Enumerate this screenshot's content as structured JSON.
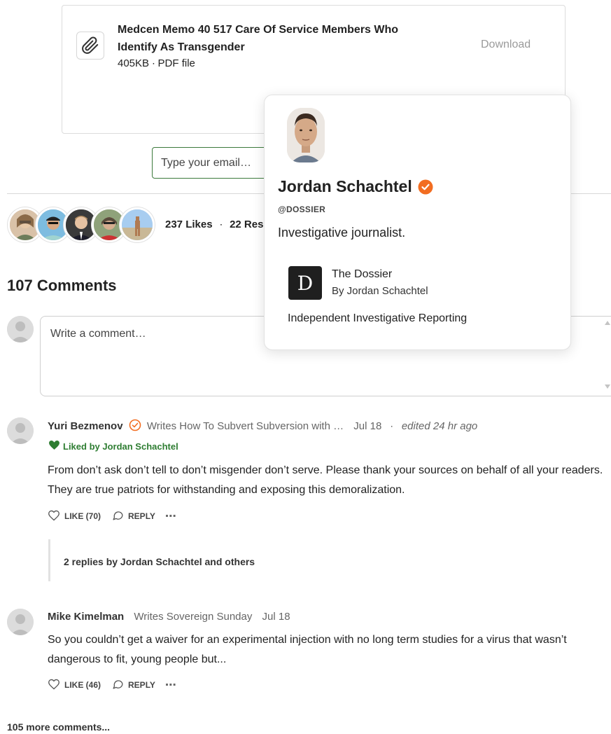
{
  "attachment": {
    "title": "Medcen Memo 40 517 Care Of Service Members Who Identify As Transgender",
    "meta": "405KB ∙ PDF file",
    "download_label": "Download"
  },
  "email": {
    "placeholder": "Type your email…"
  },
  "likes": {
    "likes_count": "237 Likes",
    "separator": "∙",
    "restacks": "22 Res"
  },
  "comments": {
    "heading": "107 Comments",
    "input_placeholder": "Write a comment…",
    "items": [
      {
        "author": "Yuri Bezmenov",
        "writes": "Writes How To Subvert Subversion with …",
        "date": "Jul 18",
        "separator": "∙",
        "edited": "edited 24 hr ago",
        "liked_by": "Liked by Jordan Schachtel",
        "body": "From don’t ask don’t tell to don’t misgender don’t serve. Please thank your sources on behalf of all your readers. They are true patriots for withstanding and exposing this demoralization.",
        "like_label": "LIKE (70)",
        "reply_label": "REPLY",
        "more": "⋯"
      },
      {
        "author": "Mike Kimelman",
        "writes": "Writes Sovereign Sunday",
        "date": "Jul 18",
        "body": "So you couldn’t get a waiver for an experimental injection with no long term studies for a virus that wasn’t dangerous to fit, young people but...",
        "like_label": "LIKE (46)",
        "reply_label": "REPLY",
        "more": "⋯"
      }
    ],
    "replies_link": "2 replies by Jordan Schachtel and others",
    "more_comments": "105 more comments..."
  },
  "hover_card": {
    "name": "Jordan Schachtel",
    "handle": "@DOSSIER",
    "bio": "Investigative journalist.",
    "publication": {
      "logo_letter": "D",
      "name": "The Dossier",
      "by": "By Jordan Schachtel",
      "description": "Independent Investigative Reporting"
    }
  },
  "colors": {
    "verified_badge": "#f26d21",
    "liked_green": "#2e7d32",
    "input_border": "#3b7a3b"
  },
  "icons": {
    "attachment": "paperclip-icon",
    "verified": "verified-badge-icon",
    "heart": "heart-icon",
    "like": "heart-outline-icon",
    "reply": "speech-bubble-icon"
  }
}
